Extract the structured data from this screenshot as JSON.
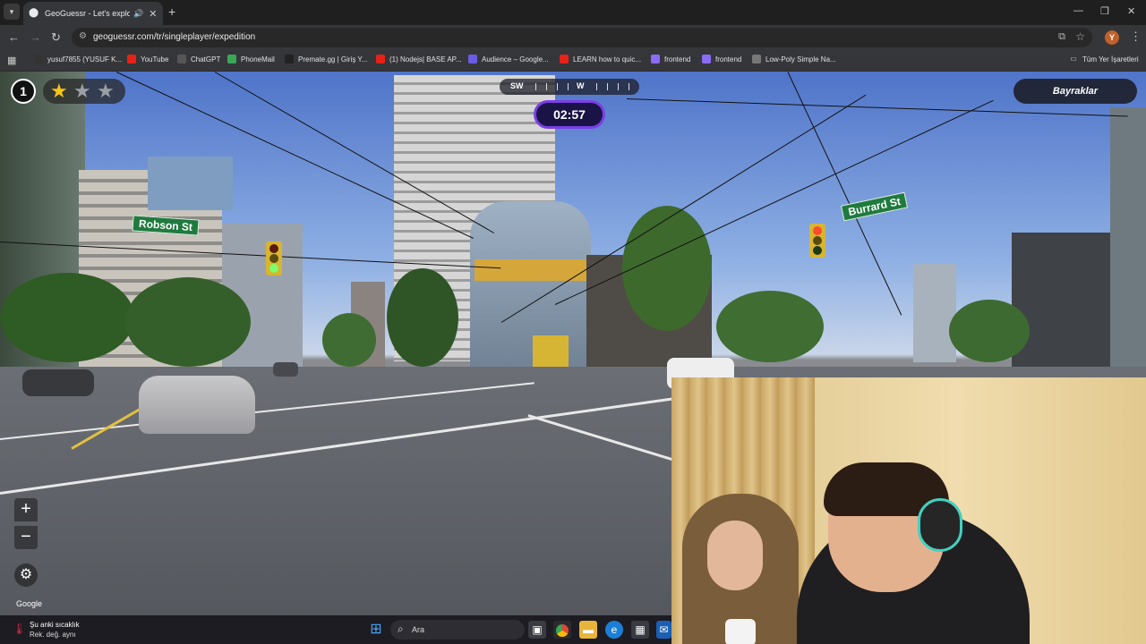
{
  "browser": {
    "tab_title": "GeoGuessr - Let's explore t",
    "new_tab": "+",
    "url": "geoguessr.com/tr/singleplayer/expedition",
    "avatar_letter": "Y",
    "bookmarks": [
      {
        "label": "yusuf7855 (YUSUF K...",
        "color": "#333333",
        "icon": "github-icon"
      },
      {
        "label": "YouTube",
        "color": "#e62117",
        "icon": "youtube-icon"
      },
      {
        "label": "ChatGPT",
        "color": "#555555",
        "icon": "chatgpt-icon"
      },
      {
        "label": "PhoneMail",
        "color": "#3aa757",
        "icon": "mail-icon"
      },
      {
        "label": "Premate.gg | Giriş Y...",
        "color": "#222222",
        "icon": "premate-icon"
      },
      {
        "label": "(1) Nodejs| BASE AP...",
        "color": "#e62117",
        "icon": "youtube-icon"
      },
      {
        "label": "Audience – Google...",
        "color": "#6b5ce7",
        "icon": "audience-icon"
      },
      {
        "label": "LEARN how to quic...",
        "color": "#e62117",
        "icon": "youtube-icon"
      },
      {
        "label": "frontend",
        "color": "#8b6cf6",
        "icon": "frontend-icon"
      },
      {
        "label": "frontend",
        "color": "#8b6cf6",
        "icon": "frontend-icon"
      },
      {
        "label": "Low-Poly Simple Na...",
        "color": "#777777",
        "icon": "lowpoly-icon"
      }
    ],
    "all_bookmarks": "Tüm Yer İşaretleri"
  },
  "game": {
    "round": "1",
    "stars_filled": 1,
    "stars_total": 3,
    "compass": {
      "left": "SW",
      "right": "W"
    },
    "timer": "02:57",
    "flags_button": "Bayraklar",
    "signs": {
      "left": "Robson St",
      "right": "Burrard St"
    },
    "zoom_in": "+",
    "zoom_out": "−",
    "attribution": "Google"
  },
  "taskbar": {
    "weather_line1": "Şu anki sıcaklık",
    "weather_line2": "Rek. değ. aynı",
    "search_placeholder": "Ara"
  },
  "colors": {
    "timer_border": "#7b3fe4",
    "timer_bg": "#1a1446",
    "star_filled": "#f5c518",
    "star_empty": "#9aa0a6"
  }
}
